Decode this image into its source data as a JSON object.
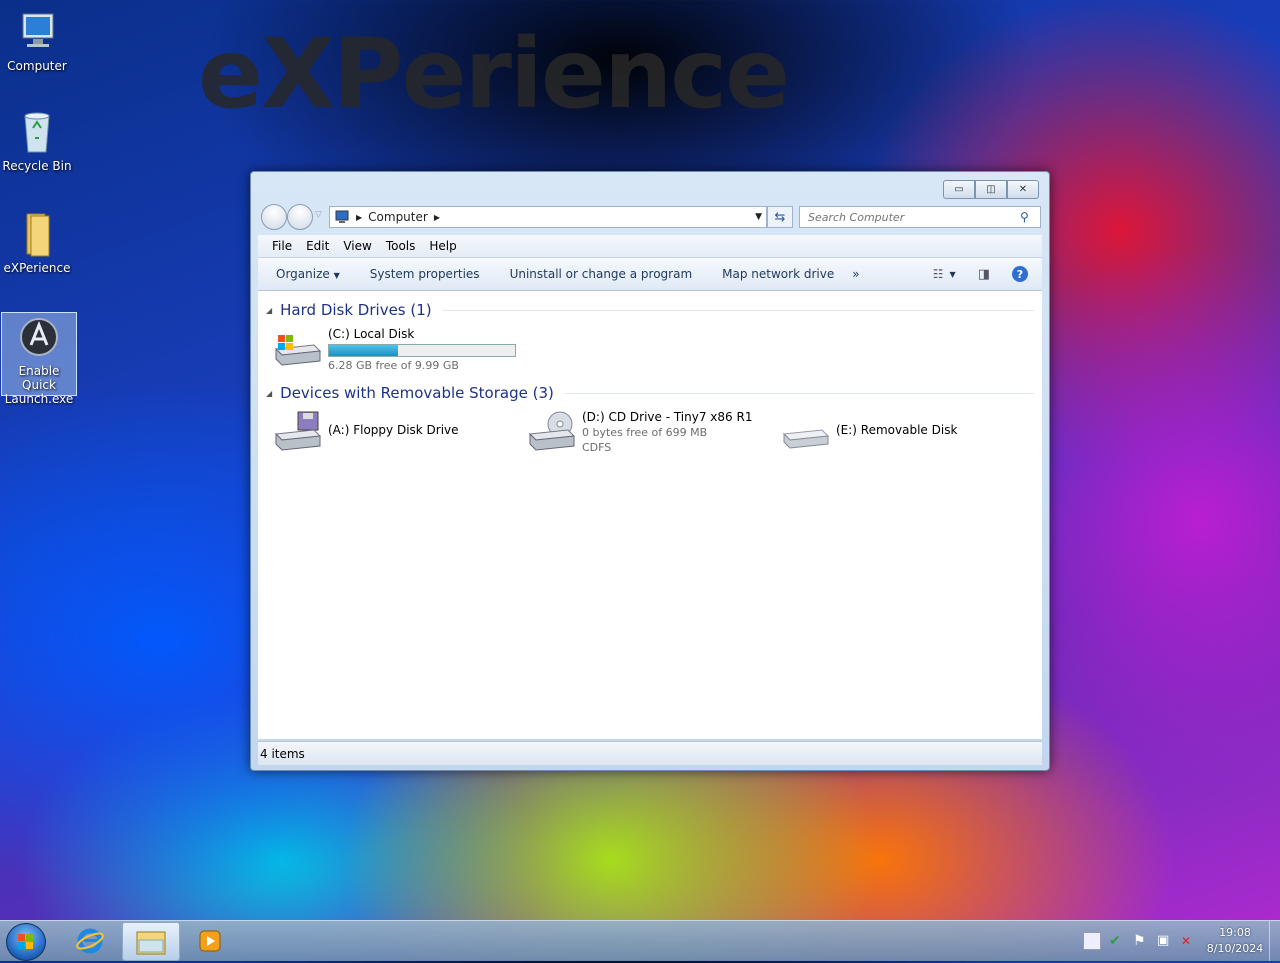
{
  "wallpaper": {
    "text": "eXPerience"
  },
  "desktop": {
    "icons": [
      {
        "label": "Computer"
      },
      {
        "label": "Recycle Bin"
      },
      {
        "label": "eXPerience"
      },
      {
        "label": "Enable Quick Launch.exe"
      }
    ]
  },
  "window": {
    "address": {
      "segment": "Computer"
    },
    "search": {
      "placeholder": "Search Computer"
    },
    "menu": [
      "File",
      "Edit",
      "View",
      "Tools",
      "Help"
    ],
    "commands": {
      "organize": "Organize",
      "system_properties": "System properties",
      "uninstall": "Uninstall or change a program",
      "map_drive": "Map network drive",
      "more": "»"
    },
    "groups": [
      {
        "title": "Hard Disk Drives (1)",
        "drives": [
          {
            "name": "(C:) Local Disk",
            "free_text": "6.28 GB free of 9.99 GB",
            "used_fraction": 0.37
          }
        ]
      },
      {
        "title": "Devices with Removable Storage (3)",
        "drives": [
          {
            "name": "(A:) Floppy Disk Drive"
          },
          {
            "name": "(D:) CD Drive - Tiny7 x86 R1",
            "free_text": "0 bytes free of 699 MB",
            "fs": "CDFS"
          },
          {
            "name": "(E:) Removable Disk"
          }
        ]
      }
    ],
    "status": {
      "items": "4 items"
    }
  },
  "taskbar": {
    "clock": {
      "time": "19:08",
      "date": "8/10/2024"
    }
  },
  "colors": {
    "accent": "#1e3287",
    "progress": "#1d8fc0"
  }
}
